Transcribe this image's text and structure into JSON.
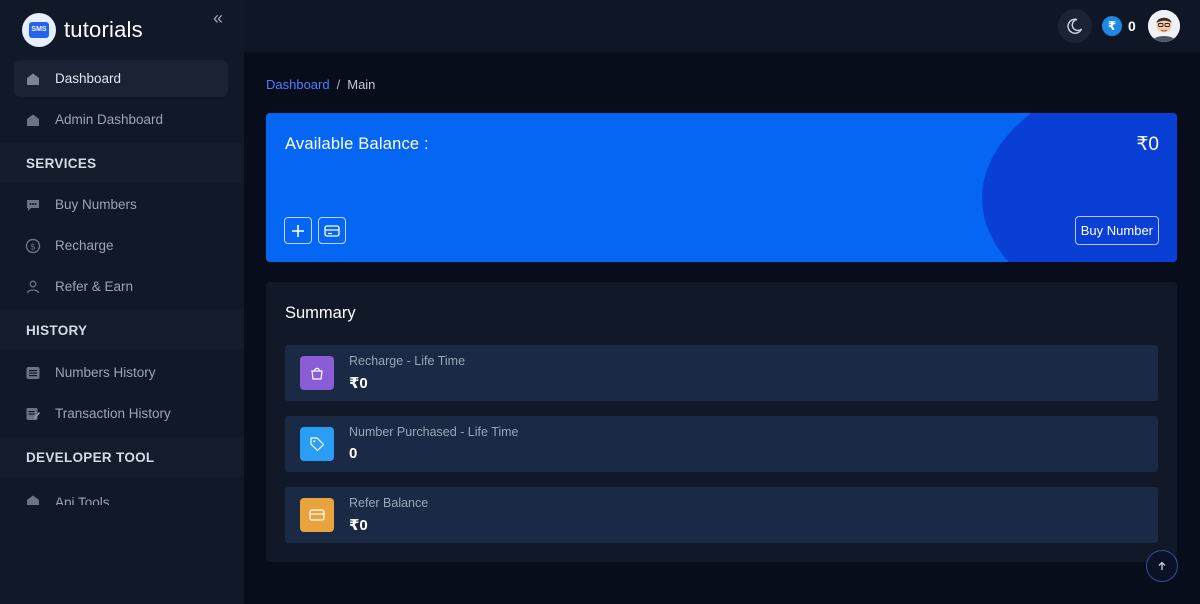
{
  "brand": {
    "name": "tutorials",
    "logo_text": "SMS"
  },
  "sidebar": {
    "collapse_icon": "double-chevron-left-icon",
    "items": [
      {
        "label": "Dashboard",
        "icon": "home-icon"
      },
      {
        "label": "Admin Dashboard",
        "icon": "home-icon"
      }
    ],
    "sections": [
      {
        "title": "SERVICES",
        "items": [
          {
            "label": "Buy Numbers",
            "icon": "chat-icon"
          },
          {
            "label": "Recharge",
            "icon": "dollar-coin-icon"
          },
          {
            "label": "Refer & Earn",
            "icon": "users-icon"
          }
        ]
      },
      {
        "title": "HISTORY",
        "items": [
          {
            "label": "Numbers History",
            "icon": "list-icon"
          },
          {
            "label": "Transaction History",
            "icon": "edit-document-icon"
          }
        ]
      },
      {
        "title": "DEVELOPER TOOL",
        "items": [
          {
            "label": "Api Tools",
            "icon": "home-icon"
          }
        ]
      }
    ]
  },
  "topbar": {
    "theme_icon": "moon-icon",
    "wallet_symbol": "₹",
    "wallet_value": "0",
    "avatar": "user-avatar"
  },
  "breadcrumb": {
    "link": "Dashboard",
    "separator": "/",
    "current": "Main"
  },
  "balance": {
    "title": "Available Balance :",
    "amount": "₹0",
    "buy_button": "Buy Number",
    "actions": [
      "plus-icon",
      "card-icon"
    ]
  },
  "summary": {
    "title": "Summary",
    "stats": [
      {
        "label": "Recharge - Life Time",
        "value": "₹0",
        "icon": "bag-icon",
        "color": "#8a5cd6"
      },
      {
        "label": "Number Purchased - Life Time",
        "value": "0",
        "icon": "tag-icon",
        "color": "#2a9df4"
      },
      {
        "label": "Refer Balance",
        "value": "₹0",
        "icon": "card-icon",
        "color": "#e8a33d"
      }
    ]
  },
  "colors": {
    "accent": "#0466f2",
    "link": "#4f7dff",
    "background": "#070d1b"
  }
}
